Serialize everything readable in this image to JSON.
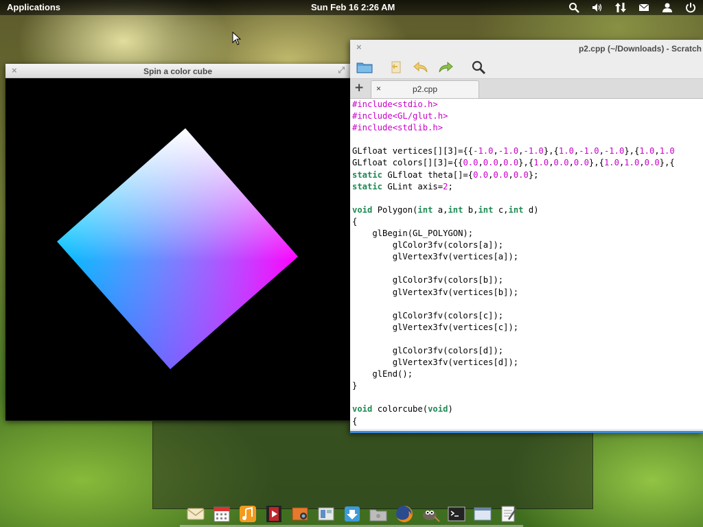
{
  "panel": {
    "applications_label": "Applications",
    "clock": "Sun Feb 16  2:26 AM",
    "indicators": [
      "search-icon",
      "volume-icon",
      "network-icon",
      "mail-icon",
      "user-icon",
      "power-icon"
    ]
  },
  "cube_window": {
    "title": "Spin a color cube",
    "close_glyph": "×",
    "maximize_glyph": "⤢"
  },
  "editor": {
    "title": "p2.cpp (~/Downloads) - Scratch",
    "close_glyph": "×",
    "toolbar": [
      "open-folder-icon",
      "revert-icon",
      "undo-icon",
      "redo-icon",
      "search-icon"
    ],
    "new_tab_glyph": "+",
    "tab": {
      "label": "p2.cpp",
      "close_glyph": "×"
    },
    "code_lines": [
      [
        [
          "pp",
          "#include<stdio.h>"
        ]
      ],
      [
        [
          "pp",
          "#include<GL/glut.h>"
        ]
      ],
      [
        [
          "pp",
          "#include<stdlib.h>"
        ]
      ],
      [],
      [
        [
          "tx",
          "GLfloat vertices[][3]={{"
        ],
        [
          "num",
          "-1.0"
        ],
        [
          "tx",
          ","
        ],
        [
          "num",
          "-1.0"
        ],
        [
          "tx",
          ","
        ],
        [
          "num",
          "-1.0"
        ],
        [
          "tx",
          "},{"
        ],
        [
          "num",
          "1.0"
        ],
        [
          "tx",
          ","
        ],
        [
          "num",
          "-1.0"
        ],
        [
          "tx",
          ","
        ],
        [
          "num",
          "-1.0"
        ],
        [
          "tx",
          "},{"
        ],
        [
          "num",
          "1.0"
        ],
        [
          "tx",
          ","
        ],
        [
          "num",
          "1.0"
        ]
      ],
      [
        [
          "tx",
          "GLfloat colors[][3]={{"
        ],
        [
          "num",
          "0.0"
        ],
        [
          "tx",
          ","
        ],
        [
          "num",
          "0.0"
        ],
        [
          "tx",
          ","
        ],
        [
          "num",
          "0.0"
        ],
        [
          "tx",
          "},{"
        ],
        [
          "num",
          "1.0"
        ],
        [
          "tx",
          ","
        ],
        [
          "num",
          "0.0"
        ],
        [
          "tx",
          ","
        ],
        [
          "num",
          "0.0"
        ],
        [
          "tx",
          "},{"
        ],
        [
          "num",
          "1.0"
        ],
        [
          "tx",
          ","
        ],
        [
          "num",
          "1.0"
        ],
        [
          "tx",
          ","
        ],
        [
          "num",
          "0.0"
        ],
        [
          "tx",
          "},{"
        ]
      ],
      [
        [
          "kw",
          "static"
        ],
        [
          "tx",
          " GLfloat theta[]={"
        ],
        [
          "num",
          "0.0"
        ],
        [
          "tx",
          ","
        ],
        [
          "num",
          "0.0"
        ],
        [
          "tx",
          ","
        ],
        [
          "num",
          "0.0"
        ],
        [
          "tx",
          "};"
        ]
      ],
      [
        [
          "kw",
          "static"
        ],
        [
          "tx",
          " GLint axis="
        ],
        [
          "num",
          "2"
        ],
        [
          "tx",
          ";"
        ]
      ],
      [],
      [
        [
          "kw",
          "void"
        ],
        [
          "tx",
          " Polygon("
        ],
        [
          "kw",
          "int"
        ],
        [
          "tx",
          " a,"
        ],
        [
          "kw",
          "int"
        ],
        [
          "tx",
          " b,"
        ],
        [
          "kw",
          "int"
        ],
        [
          "tx",
          " c,"
        ],
        [
          "kw",
          "int"
        ],
        [
          "tx",
          " d)"
        ]
      ],
      [
        [
          "tx",
          "{"
        ]
      ],
      [
        [
          "tx",
          "    glBegin(GL_POLYGON);"
        ]
      ],
      [
        [
          "tx",
          "        glColor3fv(colors[a]);"
        ]
      ],
      [
        [
          "tx",
          "        glVertex3fv(vertices[a]);"
        ]
      ],
      [],
      [
        [
          "tx",
          "        glColor3fv(colors[b]);"
        ]
      ],
      [
        [
          "tx",
          "        glVertex3fv(vertices[b]);"
        ]
      ],
      [],
      [
        [
          "tx",
          "        glColor3fv(colors[c]);"
        ]
      ],
      [
        [
          "tx",
          "        glVertex3fv(vertices[c]);"
        ]
      ],
      [],
      [
        [
          "tx",
          "        glColor3fv(colors[d]);"
        ]
      ],
      [
        [
          "tx",
          "        glVertex3fv(vertices[d]);"
        ]
      ],
      [
        [
          "tx",
          "    glEnd();"
        ]
      ],
      [
        [
          "tx",
          "}"
        ]
      ],
      [],
      [
        [
          "kw",
          "void"
        ],
        [
          "tx",
          " colorcube("
        ],
        [
          "kw",
          "void"
        ],
        [
          "tx",
          ")"
        ]
      ],
      [
        [
          "tx",
          "{"
        ]
      ]
    ],
    "colors": {
      "preprocessor": "#c800c8",
      "keyword": "#1c8a52",
      "number": "#c800c8"
    }
  },
  "dock": {
    "items": [
      "mail-icon",
      "calendar-icon",
      "music-icon",
      "video-icon",
      "photos-icon",
      "workspaces-icon",
      "downloads-icon",
      "files-icon",
      "firefox-icon",
      "gimp-icon",
      "terminal-icon",
      "window-icon",
      "text-editor-icon"
    ]
  }
}
